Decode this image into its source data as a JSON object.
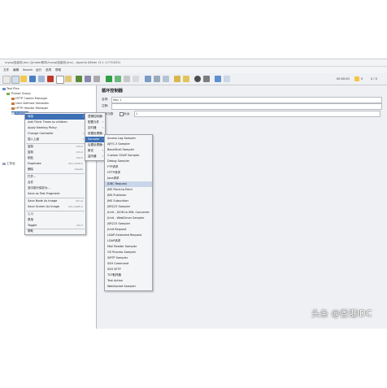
{
  "window": {
    "title": "mysql连接测.jmx (/jmeter脚本/mysql连接测.jmx) - Apache JMeter (3.1 r1770033)"
  },
  "menubar": [
    "文件",
    "编辑",
    "Search",
    "运行",
    "选项",
    "帮助"
  ],
  "toolbar": {
    "time": "00:00:00",
    "warn": "0",
    "count": "0 / 0"
  },
  "tree": {
    "items": [
      "Test Plan",
      "Thread Group",
      "HTTP Cookie Manager",
      "User Defined Variables",
      "HTTP Header Manager",
      "mysql...",
      "工作台"
    ]
  },
  "panel": {
    "heading": "循环控制器",
    "name_label": "名称:",
    "name_value": "Way 1",
    "comment_label": "注释:",
    "loop_label": "循环次数",
    "forever_label": "永远",
    "forever_value": "1"
  },
  "context_menu": {
    "items": [
      {
        "label": "添加",
        "sc": ""
      },
      {
        "label": "Add Think Times to children",
        "sc": ""
      },
      {
        "label": "Apply Naming Policy",
        "sc": ""
      },
      {
        "label": "Change Controller",
        "sc": ""
      },
      {
        "label": "插入上级",
        "sc": ""
      },
      {
        "label": "复制",
        "sc": "Ctrl-X"
      },
      {
        "label": "复制",
        "sc": "Ctrl-C"
      },
      {
        "label": "粘贴",
        "sc": "Ctrl-V"
      },
      {
        "label": "Duplicate",
        "sc": "Ctrl+Shift-C"
      },
      {
        "label": "删除",
        "sc": "Delete"
      },
      {
        "label": "打开...",
        "sc": ""
      },
      {
        "label": "合并",
        "sc": ""
      },
      {
        "label": "选中部分保存为...",
        "sc": ""
      },
      {
        "label": "Save as Test Fragment",
        "sc": ""
      },
      {
        "label": "Save Node As Image",
        "sc": "Ctrl-G"
      },
      {
        "label": "Save Screen As Image",
        "sc": "Ctrl+Shift-G"
      },
      {
        "label": "启用",
        "sc": ""
      },
      {
        "label": "禁用",
        "sc": ""
      },
      {
        "label": "Toggle",
        "sc": "Ctrl-T"
      },
      {
        "label": "帮助",
        "sc": ""
      }
    ]
  },
  "submenu1": {
    "items": [
      "逻辑控制器",
      "配置元件",
      "定时器",
      "前置处理器",
      "Sampler",
      "后置处理器",
      "断言",
      "监听器"
    ]
  },
  "submenu2": {
    "items": [
      "Access Log Sampler",
      "AJP/1.3 Sampler",
      "BeanShell Sampler",
      "Custom SOAP Sampler",
      "Debug Sampler",
      "FTP请求",
      "HTTP请求",
      "Java请求",
      "JDBC Request",
      "JMS Point-to-Point",
      "JMS Publisher",
      "JMS Subscriber",
      "JSR223 Sampler",
      "JUnit - JSON to XML Converter",
      "JUnit - WebDriver Sampler",
      "JSR223 Sampler",
      "JUnit Request",
      "LDAP Extended Request",
      "LDAP请求",
      "Mail Reader Sampler",
      "OS Process Sampler",
      "SMTP Sampler",
      "SSH Command",
      "SSH SFTP",
      "TCP取样器",
      "Test Action",
      "WebSocket Sampler"
    ]
  },
  "watermark": "头条 @香港IDC",
  "colors": {
    "selection": "#3d6fb4",
    "highlight": "#c9d6ea",
    "window_bg": "#eceff3"
  }
}
